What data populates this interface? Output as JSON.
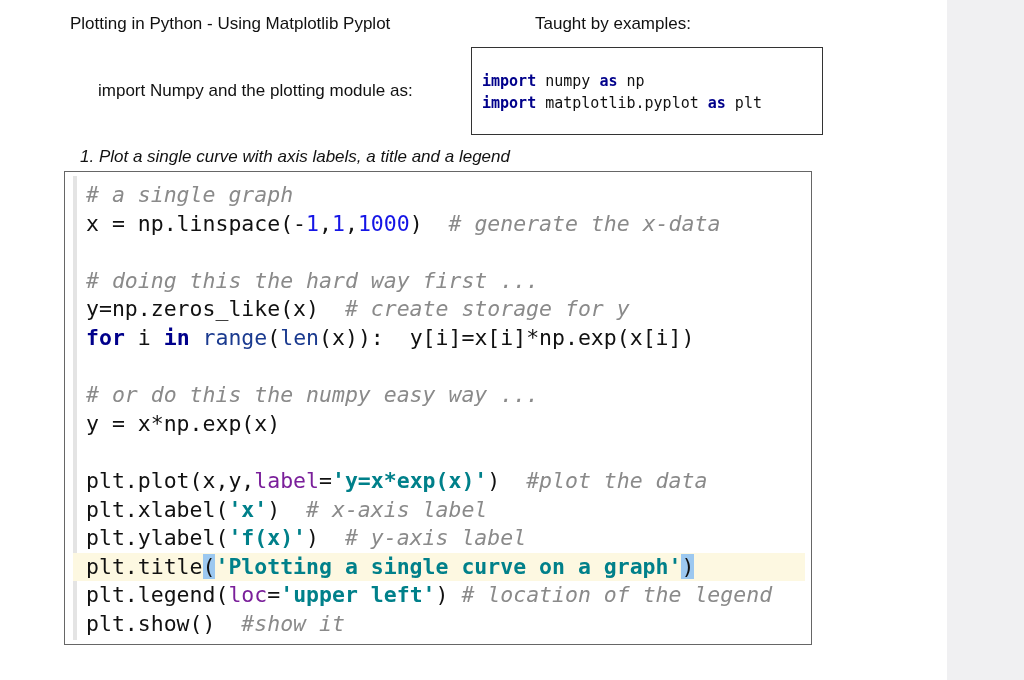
{
  "header": {
    "title": "Plotting in Python - Using Matplotlib Pyplot",
    "subtitle": "Taught by examples:"
  },
  "import_section": {
    "label": "import Numpy and the plotting module as:",
    "lines": [
      [
        {
          "kind": "keyword",
          "text": "import"
        },
        {
          "kind": "plain",
          "text": " numpy "
        },
        {
          "kind": "keyword",
          "text": "as"
        },
        {
          "kind": "plain",
          "text": " np"
        }
      ],
      [
        {
          "kind": "keyword",
          "text": "import"
        },
        {
          "kind": "plain",
          "text": " matplotlib.pyplot "
        },
        {
          "kind": "keyword",
          "text": "as"
        },
        {
          "kind": "plain",
          "text": " plt"
        }
      ]
    ]
  },
  "example": {
    "heading": "1. Plot a single curve with axis labels, a title and a legend",
    "blocks": [
      [
        {
          "highlighted": false,
          "tokens": [
            {
              "kind": "comment",
              "text": "# a single graph"
            }
          ]
        },
        {
          "highlighted": false,
          "tokens": [
            {
              "kind": "plain",
              "text": "x = np.linspace(-"
            },
            {
              "kind": "number",
              "text": "1"
            },
            {
              "kind": "plain",
              "text": ","
            },
            {
              "kind": "number",
              "text": "1"
            },
            {
              "kind": "plain",
              "text": ","
            },
            {
              "kind": "number",
              "text": "1000"
            },
            {
              "kind": "plain",
              "text": ")  "
            },
            {
              "kind": "comment",
              "text": "# generate the x-data"
            }
          ]
        }
      ],
      [
        {
          "highlighted": false,
          "tokens": [
            {
              "kind": "comment",
              "text": "# doing this the hard way first ..."
            }
          ]
        },
        {
          "highlighted": false,
          "tokens": [
            {
              "kind": "plain",
              "text": "y=np.zeros_like(x)  "
            },
            {
              "kind": "comment",
              "text": "# create storage for y"
            }
          ]
        },
        {
          "highlighted": false,
          "tokens": [
            {
              "kind": "keyword",
              "text": "for"
            },
            {
              "kind": "plain",
              "text": " i "
            },
            {
              "kind": "keyword",
              "text": "in"
            },
            {
              "kind": "builtin",
              "text": " range"
            },
            {
              "kind": "plain",
              "text": "("
            },
            {
              "kind": "builtin",
              "text": "len"
            },
            {
              "kind": "plain",
              "text": "(x)):  y[i]=x[i]*np.exp(x[i])"
            }
          ]
        }
      ],
      [
        {
          "highlighted": false,
          "tokens": [
            {
              "kind": "comment",
              "text": "# or do this the numpy easy way ..."
            }
          ]
        },
        {
          "highlighted": false,
          "tokens": [
            {
              "kind": "plain",
              "text": "y = x*np.exp(x)"
            }
          ]
        }
      ],
      [
        {
          "highlighted": false,
          "tokens": [
            {
              "kind": "plain",
              "text": "plt.plot(x,y,"
            },
            {
              "kind": "param",
              "text": "label"
            },
            {
              "kind": "plain",
              "text": "="
            },
            {
              "kind": "string",
              "text": "'y=x*exp(x)'"
            },
            {
              "kind": "plain",
              "text": ")  "
            },
            {
              "kind": "comment",
              "text": "#plot the data"
            }
          ]
        },
        {
          "highlighted": false,
          "tokens": [
            {
              "kind": "plain",
              "text": "plt.xlabel("
            },
            {
              "kind": "string",
              "text": "'x'"
            },
            {
              "kind": "plain",
              "text": ")  "
            },
            {
              "kind": "comment",
              "text": "# x-axis label"
            }
          ]
        },
        {
          "highlighted": false,
          "tokens": [
            {
              "kind": "plain",
              "text": "plt.ylabel("
            },
            {
              "kind": "string",
              "text": "'f(x)'"
            },
            {
              "kind": "plain",
              "text": ")  "
            },
            {
              "kind": "comment",
              "text": "# y-axis label"
            }
          ]
        },
        {
          "highlighted": true,
          "tokens": [
            {
              "kind": "plain",
              "text": "plt.title"
            },
            {
              "kind": "match",
              "text": "("
            },
            {
              "kind": "string",
              "text": "'Plotting a single curve on a graph'"
            },
            {
              "kind": "match",
              "text": ")"
            }
          ]
        },
        {
          "highlighted": false,
          "tokens": [
            {
              "kind": "plain",
              "text": "plt.legend("
            },
            {
              "kind": "param",
              "text": "loc"
            },
            {
              "kind": "plain",
              "text": "="
            },
            {
              "kind": "string",
              "text": "'upper left'"
            },
            {
              "kind": "plain",
              "text": ") "
            },
            {
              "kind": "comment",
              "text": "# location of the legend"
            }
          ]
        },
        {
          "highlighted": false,
          "tokens": [
            {
              "kind": "plain",
              "text": "plt.show()  "
            },
            {
              "kind": "comment",
              "text": "#show it"
            }
          ]
        }
      ]
    ]
  }
}
